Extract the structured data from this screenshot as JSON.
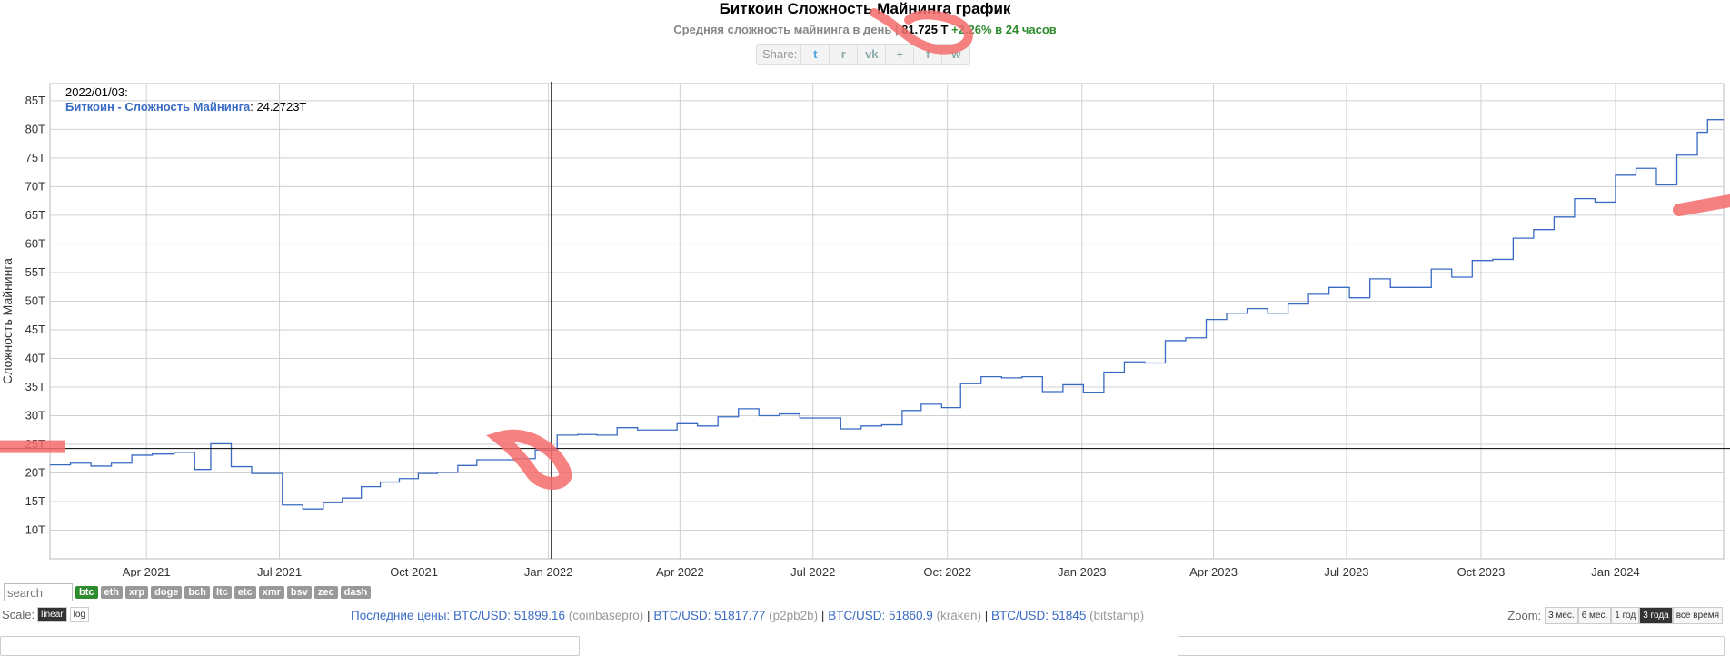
{
  "header": {
    "title": "Биткоин Сложность Майнинга график",
    "subtitle_prefix": "Средняя сложность майнинга в день | ",
    "subtitle_value": "81.725 T",
    "subtitle_change": " +2.26% в 24 часов",
    "share_label": "Share:"
  },
  "share_icons": [
    {
      "name": "twitter-icon",
      "glyph": "t"
    },
    {
      "name": "reddit-icon",
      "glyph": "r"
    },
    {
      "name": "vk-icon",
      "glyph": "vk"
    },
    {
      "name": "like-icon",
      "glyph": "+"
    },
    {
      "name": "facebook-icon",
      "glyph": "f"
    },
    {
      "name": "weibo-icon",
      "glyph": "w"
    }
  ],
  "tooltip": {
    "date": "2022/01/03:",
    "series_label": "Биткоин - Сложность Майнинга",
    "value": ": 24.2723T"
  },
  "chart_data": {
    "type": "line",
    "ylabel": "Сложность Майнинга",
    "xlabel": "",
    "ylim": [
      5,
      88
    ],
    "xlim": [
      "2021-01-25",
      "2024-03-15"
    ],
    "y_ticks": [
      "10T",
      "15T",
      "20T",
      "25T",
      "30T",
      "35T",
      "40T",
      "45T",
      "50T",
      "55T",
      "60T",
      "65T",
      "70T",
      "75T",
      "80T",
      "85T"
    ],
    "x_ticks": [
      {
        "date": "2021-04-01",
        "label": "Apr 2021"
      },
      {
        "date": "2021-07-01",
        "label": "Jul 2021"
      },
      {
        "date": "2021-10-01",
        "label": "Oct 2021"
      },
      {
        "date": "2022-01-01",
        "label": "Jan 2022"
      },
      {
        "date": "2022-04-01",
        "label": "Apr 2022"
      },
      {
        "date": "2022-07-01",
        "label": "Jul 2022"
      },
      {
        "date": "2022-10-01",
        "label": "Oct 2022"
      },
      {
        "date": "2023-01-01",
        "label": "Jan 2023"
      },
      {
        "date": "2023-04-01",
        "label": "Apr 2023"
      },
      {
        "date": "2023-07-01",
        "label": "Jul 2023"
      },
      {
        "date": "2023-10-01",
        "label": "Oct 2023"
      },
      {
        "date": "2024-01-01",
        "label": "Jan 2024"
      }
    ],
    "crosshair": {
      "date": "2022-01-03",
      "value": 24.27
    },
    "grid": true,
    "series": [
      {
        "name": "Биткоин - Сложность Майнинга",
        "color": "#3a6bc4",
        "step": true,
        "points": [
          [
            "2021-01-25",
            21.4
          ],
          [
            "2021-02-08",
            21.7
          ],
          [
            "2021-02-22",
            21.2
          ],
          [
            "2021-03-08",
            21.7
          ],
          [
            "2021-03-22",
            23.1
          ],
          [
            "2021-04-05",
            23.3
          ],
          [
            "2021-04-20",
            23.6
          ],
          [
            "2021-05-04",
            20.6
          ],
          [
            "2021-05-15",
            25.1
          ],
          [
            "2021-05-29",
            21.1
          ],
          [
            "2021-06-12",
            19.9
          ],
          [
            "2021-07-03",
            14.4
          ],
          [
            "2021-07-17",
            13.7
          ],
          [
            "2021-07-31",
            14.8
          ],
          [
            "2021-08-13",
            15.6
          ],
          [
            "2021-08-26",
            17.6
          ],
          [
            "2021-09-08",
            18.4
          ],
          [
            "2021-09-21",
            19.0
          ],
          [
            "2021-10-04",
            19.9
          ],
          [
            "2021-10-17",
            20.1
          ],
          [
            "2021-10-31",
            21.3
          ],
          [
            "2021-11-13",
            22.3
          ],
          [
            "2021-11-26",
            22.3
          ],
          [
            "2021-12-09",
            22.5
          ],
          [
            "2021-12-23",
            24.0
          ],
          [
            "2022-01-07",
            26.6
          ],
          [
            "2022-01-21",
            26.7
          ],
          [
            "2022-02-03",
            26.6
          ],
          [
            "2022-02-17",
            27.9
          ],
          [
            "2022-03-03",
            27.5
          ],
          [
            "2022-03-17",
            27.5
          ],
          [
            "2022-03-30",
            28.6
          ],
          [
            "2022-04-13",
            28.2
          ],
          [
            "2022-04-27",
            29.8
          ],
          [
            "2022-05-11",
            31.2
          ],
          [
            "2022-05-25",
            30.0
          ],
          [
            "2022-06-08",
            30.3
          ],
          [
            "2022-06-22",
            29.6
          ],
          [
            "2022-07-06",
            29.6
          ],
          [
            "2022-07-20",
            27.7
          ],
          [
            "2022-08-03",
            28.2
          ],
          [
            "2022-08-17",
            28.4
          ],
          [
            "2022-08-31",
            30.9
          ],
          [
            "2022-09-13",
            32.0
          ],
          [
            "2022-09-27",
            31.4
          ],
          [
            "2022-10-10",
            35.6
          ],
          [
            "2022-10-24",
            36.8
          ],
          [
            "2022-11-07",
            36.6
          ],
          [
            "2022-11-21",
            36.8
          ],
          [
            "2022-12-05",
            34.2
          ],
          [
            "2022-12-19",
            35.4
          ],
          [
            "2023-01-02",
            34.1
          ],
          [
            "2023-01-16",
            37.6
          ],
          [
            "2023-01-30",
            39.4
          ],
          [
            "2023-02-13",
            39.2
          ],
          [
            "2023-02-27",
            43.1
          ],
          [
            "2023-03-13",
            43.6
          ],
          [
            "2023-03-27",
            46.8
          ],
          [
            "2023-04-10",
            47.9
          ],
          [
            "2023-04-24",
            48.7
          ],
          [
            "2023-05-08",
            47.9
          ],
          [
            "2023-05-22",
            49.5
          ],
          [
            "2023-06-05",
            51.2
          ],
          [
            "2023-06-19",
            52.4
          ],
          [
            "2023-07-03",
            50.6
          ],
          [
            "2023-07-17",
            53.9
          ],
          [
            "2023-07-31",
            52.4
          ],
          [
            "2023-08-14",
            52.4
          ],
          [
            "2023-08-28",
            55.6
          ],
          [
            "2023-09-11",
            54.2
          ],
          [
            "2023-09-25",
            57.1
          ],
          [
            "2023-10-09",
            57.3
          ],
          [
            "2023-10-23",
            61.0
          ],
          [
            "2023-11-06",
            62.5
          ],
          [
            "2023-11-20",
            64.7
          ],
          [
            "2023-12-04",
            67.9
          ],
          [
            "2023-12-18",
            67.3
          ],
          [
            "2024-01-01",
            72.0
          ],
          [
            "2024-01-15",
            73.2
          ],
          [
            "2024-01-29",
            70.3
          ],
          [
            "2024-02-12",
            75.5
          ],
          [
            "2024-02-26",
            79.5
          ],
          [
            "2024-03-04",
            81.7
          ]
        ]
      }
    ]
  },
  "controls": {
    "search_placeholder": "search",
    "coins": [
      "btc",
      "eth",
      "xrp",
      "doge",
      "bch",
      "ltc",
      "etc",
      "xmr",
      "bsv",
      "zec",
      "dash"
    ],
    "active_coin": "btc",
    "scale_label": "Scale:",
    "scale_linear": "linear",
    "scale_log": "log",
    "zoom_label": "Zoom:",
    "zoom_options": [
      "3 мес.",
      "6 мес.",
      "1 год",
      "3 года",
      "все время"
    ],
    "active_zoom": "3 года"
  },
  "prices": {
    "label": "Последние цены: ",
    "items": [
      {
        "pair": "BTC/USD: 51899.16",
        "exchange": " (coinbasepro)"
      },
      {
        "pair": "BTC/USD: 51817.77",
        "exchange": " (p2pb2b)"
      },
      {
        "pair": "BTC/USD: 51860.9",
        "exchange": " (kraken)"
      },
      {
        "pair": "BTC/USD: 51845",
        "exchange": " (bitstamp)"
      }
    ]
  },
  "colors": {
    "line": "#3a6bc4",
    "grid": "#d0d0d0",
    "annotation": "#f46b6b",
    "active_coin": "#2e8b2e"
  }
}
